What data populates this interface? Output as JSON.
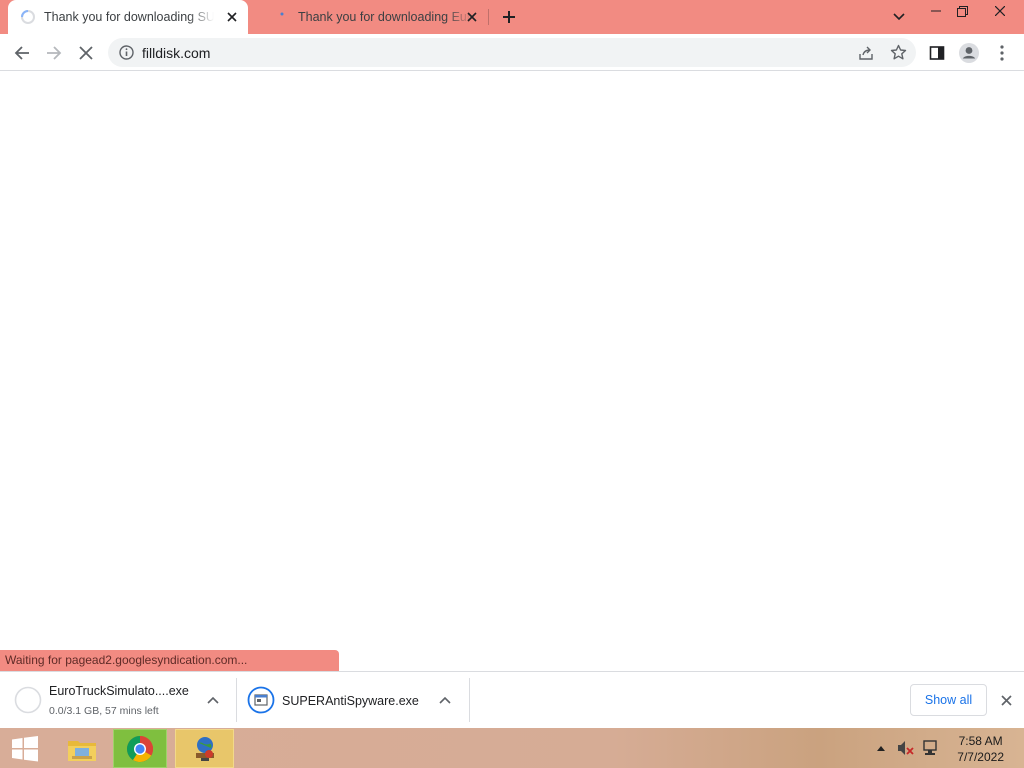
{
  "tabs": [
    {
      "title": "Thank you for downloading SUPERAntiSpyware",
      "active": true
    },
    {
      "title": "Thank you for downloading Euro Truck Simulator",
      "active": false
    }
  ],
  "toolbar": {
    "url": "filldisk.com"
  },
  "status_bubble": "Waiting for pagead2.googlesyndication.com...",
  "downloads": [
    {
      "name": "EuroTruckSimulato....exe",
      "status": "0.0/3.1 GB, 57 mins left",
      "progress": 0.0
    },
    {
      "name": "SUPERAntiSpyware.exe",
      "status": ""
    }
  ],
  "shelf": {
    "show_all_label": "Show all"
  },
  "taskbar": {
    "time": "7:58 AM",
    "date": "7/7/2022"
  },
  "colors": {
    "accent": "#f28b82",
    "link": "#1a73e8"
  }
}
